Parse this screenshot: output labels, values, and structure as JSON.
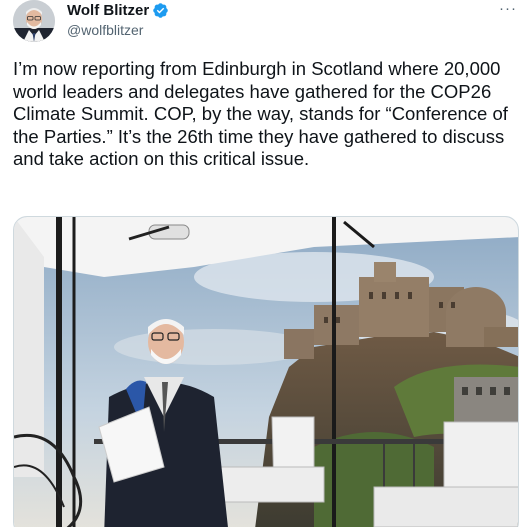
{
  "author": {
    "display_name": "Wolf Blitzer",
    "handle": "@wolfblitzer",
    "verified_icon": "verified-badge-icon",
    "avatar_icon": "avatar"
  },
  "menu": {
    "more_label": "···"
  },
  "tweet": {
    "text": "I’m now reporting from Edinburgh in Scotland where 20,000 world leaders and delegates have gathered for the COP26 Climate Summit. COP, by the way, stands for “Conference of the Parties.” It’s the 26th time they have gathered to discuss and take action on this critical issue."
  },
  "colors": {
    "text": "#0f1419",
    "secondary": "#536471",
    "verified": "#1d9bf0",
    "border": "#cfd9de"
  }
}
